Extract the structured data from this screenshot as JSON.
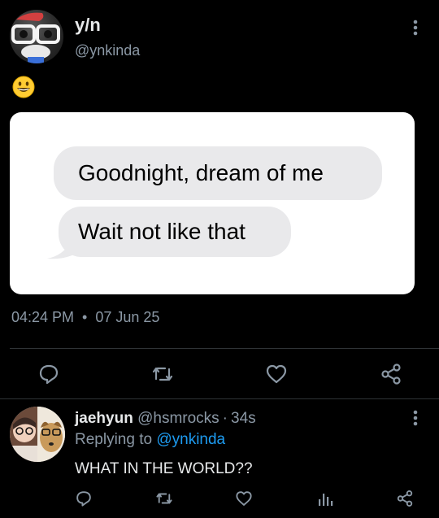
{
  "tweet": {
    "display_name": "y/n",
    "handle": "@ynkinda",
    "emoji": "grinning-face",
    "messages": [
      "Goodnight, dream of me",
      "Wait not like that"
    ],
    "time": "04:24 PM",
    "separator": "•",
    "date": "07 Jun 25",
    "actions": [
      "reply-icon",
      "retweet-icon",
      "like-icon",
      "share-icon"
    ]
  },
  "reply": {
    "display_name": "jaehyun",
    "handle": "@hsmrocks",
    "time_sep": "·",
    "time": "34s",
    "replying_prefix": "Replying to",
    "replying_to": "@ynkinda",
    "text": "WHAT IN THE WORLD??",
    "actions": [
      "reply-icon",
      "retweet-icon",
      "like-icon",
      "analytics-icon",
      "share-icon"
    ]
  },
  "colors": {
    "background": "#000000",
    "text": "#e7e9ea",
    "muted": "#8b98a5",
    "link": "#1d9bf0",
    "bubble": "#e9e9eb",
    "divider": "#2f3336"
  }
}
